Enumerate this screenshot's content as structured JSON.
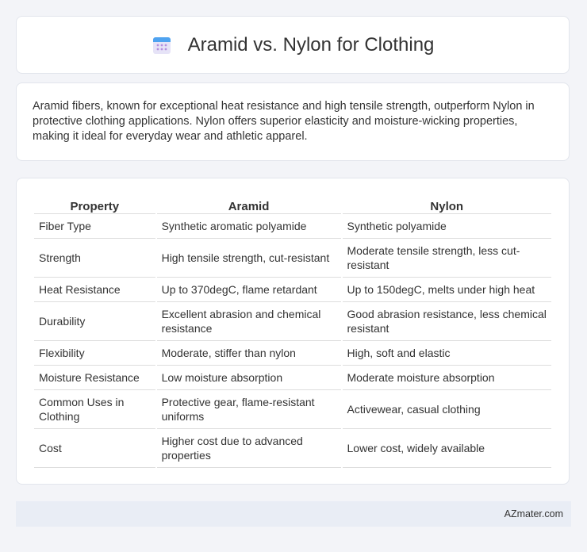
{
  "header": {
    "title": "Aramid vs. Nylon for Clothing",
    "icon": "calendar-icon"
  },
  "intro": {
    "text": "Aramid fibers, known for exceptional heat resistance and high tensile strength, outperform Nylon in protective clothing applications. Nylon offers superior elasticity and moisture-wicking properties, making it ideal for everyday wear and athletic apparel."
  },
  "table": {
    "headers": [
      "Property",
      "Aramid",
      "Nylon"
    ],
    "rows": [
      [
        "Fiber Type",
        "Synthetic aromatic polyamide",
        "Synthetic polyamide"
      ],
      [
        "Strength",
        "High tensile strength, cut-resistant",
        "Moderate tensile strength, less cut-resistant"
      ],
      [
        "Heat Resistance",
        "Up to 370degC, flame retardant",
        "Up to 150degC, melts under high heat"
      ],
      [
        "Durability",
        "Excellent abrasion and chemical resistance",
        "Good abrasion resistance, less chemical resistant"
      ],
      [
        "Flexibility",
        "Moderate, stiffer than nylon",
        "High, soft and elastic"
      ],
      [
        "Moisture Resistance",
        "Low moisture absorption",
        "Moderate moisture absorption"
      ],
      [
        "Common Uses in Clothing",
        "Protective gear, flame-resistant uniforms",
        "Activewear, casual clothing"
      ],
      [
        "Cost",
        "Higher cost due to advanced properties",
        "Lower cost, widely available"
      ]
    ]
  },
  "footer": {
    "text": "AZmater.com"
  },
  "colors": {
    "background": "#f3f4f8",
    "card": "#ffffff",
    "footer_bg": "#e9edf5",
    "icon_accent": "#7b7fd4"
  }
}
